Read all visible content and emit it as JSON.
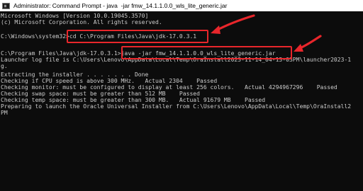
{
  "window": {
    "title": "Administrator: Command Prompt - java  -jar fmw_14.1.1.0.0_wls_lite_generic.jar",
    "icon": "cmd-icon"
  },
  "console": {
    "lines": [
      "Microsoft Windows [Version 10.0.19045.3570]",
      "(c) Microsoft Corporation. All rights reserved.",
      "",
      "C:\\Windows\\system32>cd C:\\Program Files\\Java\\jdk-17.0.3.1",
      "",
      "C:\\Program Files\\Java\\jdk-17.0.3.1>java -jar fmw_14.1.1.0.0_wls_lite_generic.jar",
      "Launcher log file is C:\\Users\\Lenovo\\AppData\\Local\\Temp\\OraInstall2023-11-14_04-13-03PM\\launcher2023-1",
      "g.",
      "Extracting the installer . . . . . . . Done",
      "Checking if CPU speed is above 300 MHz.   Actual 2304    Passed",
      "Checking monitor: must be configured to display at least 256 colors.   Actual 4294967296    Passed",
      "Checking swap space: must be greater than 512 MB    Passed",
      "Checking temp space: must be greater than 300 MB.   Actual 91679 MB    Passed",
      "Preparing to launch the Oracle Universal Installer from C:\\Users\\Lenovo\\AppData\\Local\\Temp\\OraInstall2",
      "PM"
    ]
  },
  "annotations": {
    "highlight_color": "#e8262b",
    "boxes": [
      "cd-command-highlight",
      "java-jar-command-highlight"
    ],
    "arrows": [
      "arrow-to-cd-command",
      "arrow-to-java-command"
    ]
  }
}
